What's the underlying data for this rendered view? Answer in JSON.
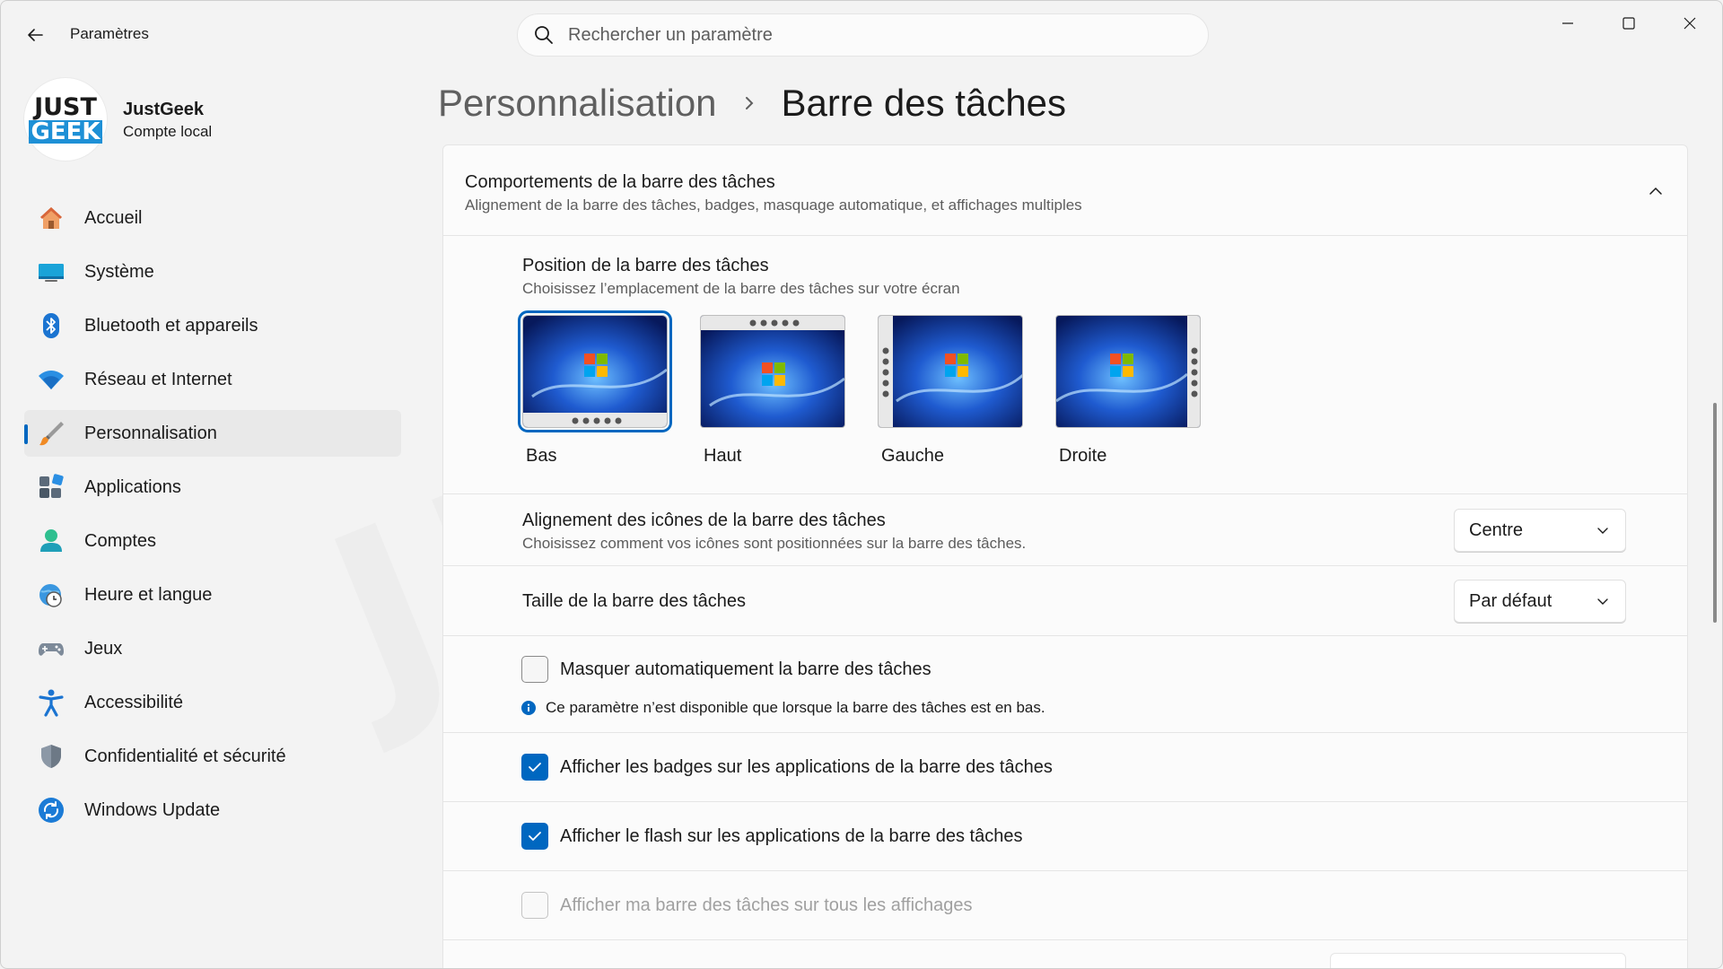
{
  "window": {
    "app_title": "Paramètres",
    "search_placeholder": "Rechercher un paramètre"
  },
  "user": {
    "avatar_line1": "JUST",
    "avatar_line2": "GEEK",
    "name": "JustGeek",
    "account_type": "Compte local"
  },
  "sidebar": {
    "items": [
      {
        "label": "Accueil",
        "icon": "home-icon"
      },
      {
        "label": "Système",
        "icon": "monitor-icon"
      },
      {
        "label": "Bluetooth et appareils",
        "icon": "bluetooth-icon"
      },
      {
        "label": "Réseau et Internet",
        "icon": "wifi-icon"
      },
      {
        "label": "Personnalisation",
        "icon": "brush-icon",
        "active": true
      },
      {
        "label": "Applications",
        "icon": "apps-icon"
      },
      {
        "label": "Comptes",
        "icon": "person-icon"
      },
      {
        "label": "Heure et langue",
        "icon": "globe-clock-icon"
      },
      {
        "label": "Jeux",
        "icon": "gamepad-icon"
      },
      {
        "label": "Accessibilité",
        "icon": "accessibility-icon"
      },
      {
        "label": "Confidentialité et sécurité",
        "icon": "shield-icon"
      },
      {
        "label": "Windows Update",
        "icon": "update-icon"
      }
    ]
  },
  "header": {
    "parent": "Personnalisation",
    "current": "Barre des tâches"
  },
  "behaviors": {
    "title": "Comportements de la barre des tâches",
    "subtitle": "Alignement de la barre des tâches, badges, masquage automatique, et affichages multiples",
    "position": {
      "title": "Position de la barre des tâches",
      "subtitle": "Choisissez l’emplacement de la barre des tâches sur votre écran",
      "options": [
        "Bas",
        "Haut",
        "Gauche",
        "Droite"
      ],
      "selected": "Bas"
    },
    "alignment": {
      "title": "Alignement des icônes de la barre des tâches",
      "subtitle": "Choisissez comment vos icônes sont positionnées sur la barre des tâches.",
      "value": "Centre"
    },
    "size": {
      "title": "Taille de la barre des tâches",
      "value": "Par défaut"
    },
    "autohide": {
      "label": "Masquer automatiquement la barre des tâches",
      "checked": false,
      "info": "Ce paramètre n’est disponible que lorsque la barre des tâches est en bas."
    },
    "badges": {
      "label": "Afficher les badges sur les applications de la barre des tâches",
      "checked": true
    },
    "flash": {
      "label": "Afficher le flash sur les applications de la barre des tâches",
      "checked": true
    },
    "all_displays": {
      "label": "Afficher ma barre des tâches sur tous les affichages",
      "checked": false,
      "disabled": true
    }
  },
  "colors": {
    "accent": "#0067c0",
    "background": "#f3f3f3",
    "card": "#fbfbfb"
  }
}
